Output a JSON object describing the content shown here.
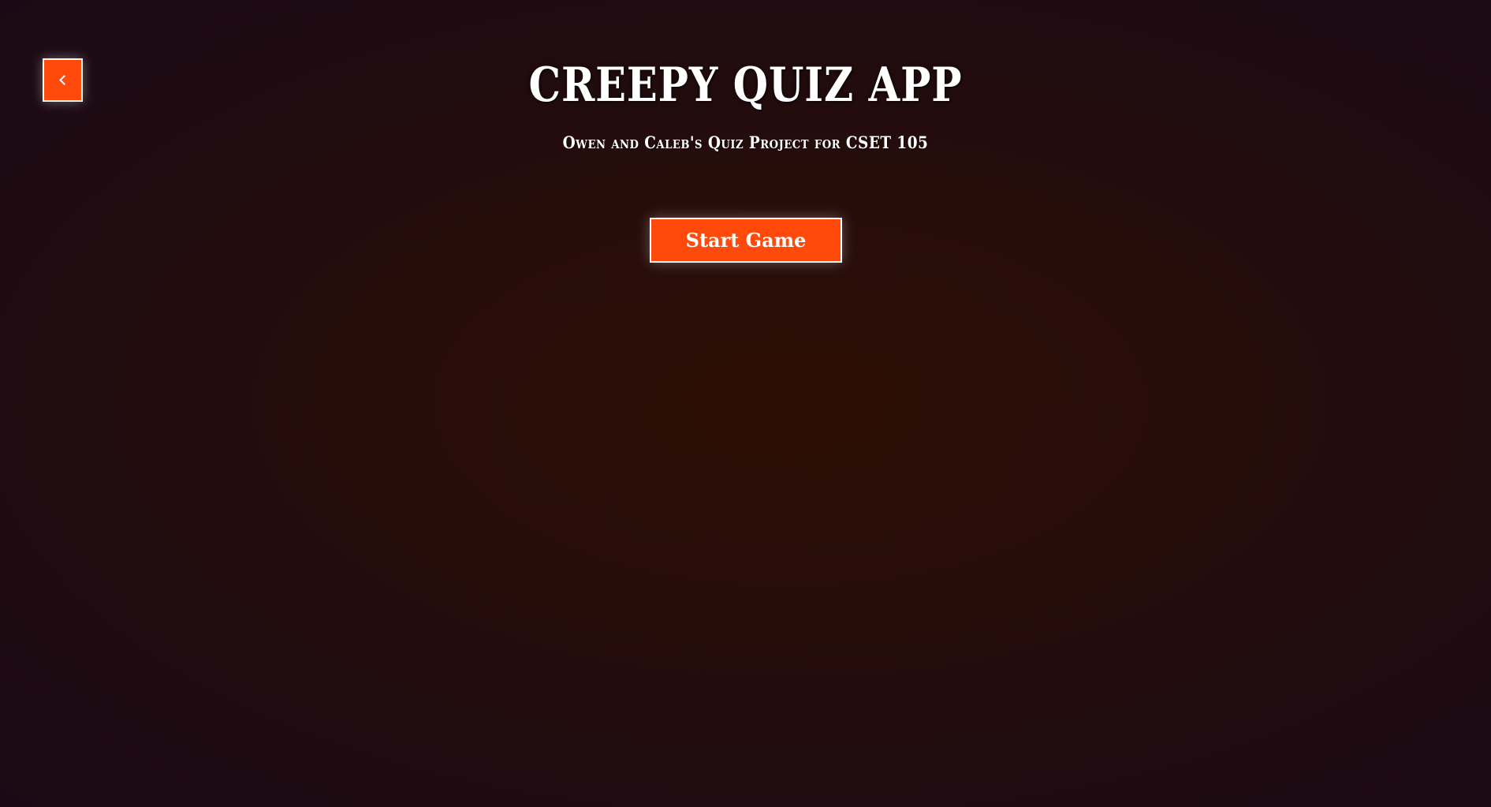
{
  "header": {
    "back_icon": "chevron-left-icon",
    "title": "CREEPY QUIZ APP",
    "subtitle": "Owen and Caleb's Quiz Project for CSET 105"
  },
  "main": {
    "start_button_label": "Start Game"
  },
  "colors": {
    "accent": "#ff4a0c",
    "background": "#220b0f",
    "text": "#ffffff"
  }
}
